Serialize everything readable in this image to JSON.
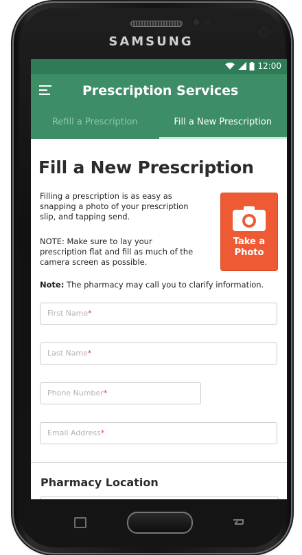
{
  "device": {
    "brand": "SAMSUNG"
  },
  "status_bar": {
    "time": "12:00"
  },
  "app_bar": {
    "title": "Prescription Services"
  },
  "tabs": [
    {
      "label": "Refill a Prescription",
      "active": false
    },
    {
      "label": "Fill a New Prescription",
      "active": true
    }
  ],
  "page": {
    "title": "Fill a New Prescription",
    "intro": "Filling a prescription is as easy as snapping a photo of your prescription slip, and tapping send.",
    "note": "NOTE: Make sure to lay your prescription flat and fill as much of the camera screen as possible.",
    "pharmacy_note_label": "Note:",
    "pharmacy_note_text": " The pharmacy may call you to clarify information.",
    "photo_button": {
      "line1": "Take a",
      "line2": "Photo",
      "icon": "camera-icon"
    }
  },
  "form": {
    "first_name": {
      "placeholder": "First Name",
      "required_mark": "*"
    },
    "last_name": {
      "placeholder": "Last Name",
      "required_mark": "*"
    },
    "phone": {
      "placeholder": "Phone Number",
      "required_mark": "*"
    },
    "email": {
      "placeholder": "Email Address",
      "required_mark": "*"
    }
  },
  "pharmacy_location": {
    "title": "Pharmacy Location"
  },
  "colors": {
    "status_bar": "#2f7a57",
    "app_bar": "#3d8e67",
    "accent": "#ee5a33",
    "required": "#e0452a"
  }
}
